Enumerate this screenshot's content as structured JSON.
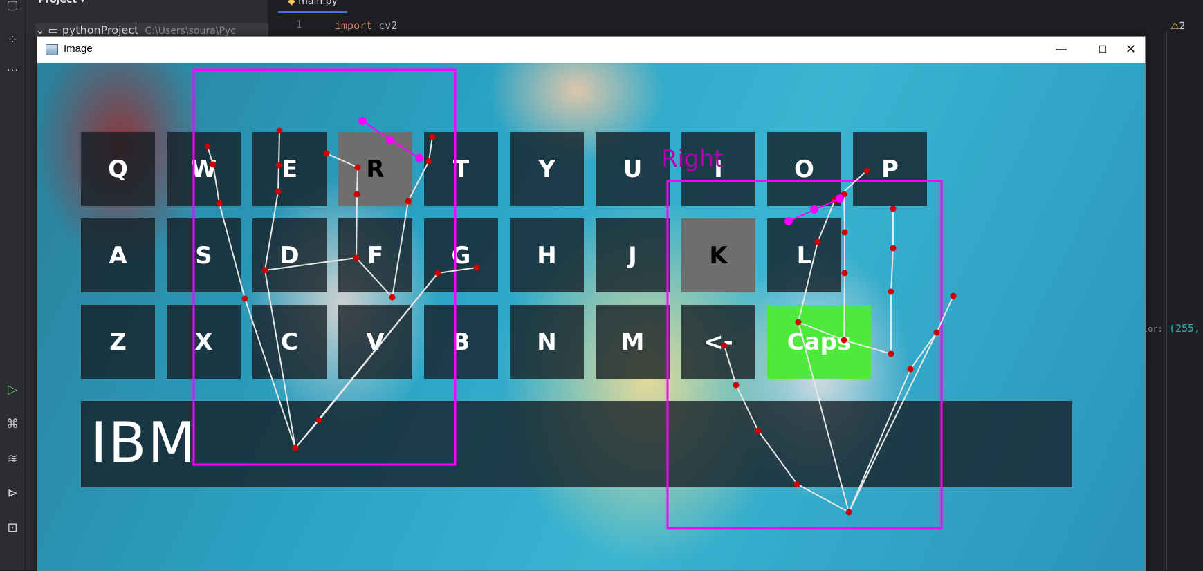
{
  "ide": {
    "project_header": "Project",
    "project_folder": "pythonProject",
    "project_path": "C:\\Users\\soura\\Pyc",
    "editor_tab": "main.py",
    "line_number": "1",
    "code_keyword": "import",
    "code_rest": " cv2",
    "warning_count": "2",
    "side_text_label": "lor:",
    "side_text_value": "(255,"
  },
  "window": {
    "title": "Image",
    "minimize_glyph": "—",
    "maximize_glyph": "☐",
    "close_glyph": "✕"
  },
  "keyboard": {
    "row1": [
      "Q",
      "W",
      "E",
      "R",
      "T",
      "Y",
      "U",
      "I",
      "O",
      "P"
    ],
    "row2": [
      "A",
      "S",
      "D",
      "F",
      "G",
      "H",
      "J",
      "K",
      "L"
    ],
    "row3": [
      "Z",
      "X",
      "C",
      "V",
      "B",
      "N",
      "M",
      "<-",
      "Caps"
    ],
    "pressed_keys": [
      "R",
      "K"
    ],
    "active_key": "Caps",
    "typed_text": "IBM"
  },
  "hand_label": "Right",
  "colors": {
    "hand_box": "#ff00ff",
    "landmark": "#d00000",
    "connection": "#e8e8e8",
    "key_bg": "#141c22",
    "key_pressed": "#6e6e6e",
    "caps_active": "#4dea3c"
  }
}
